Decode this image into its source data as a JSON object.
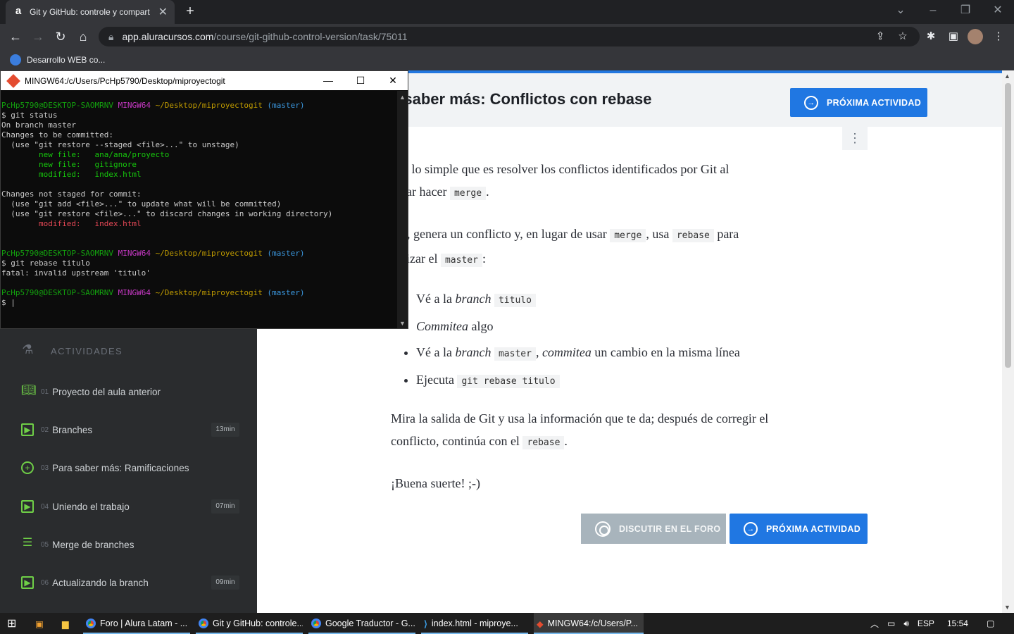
{
  "browser": {
    "tab_title": "Git y GitHub: controle y compart",
    "tab_favicon": "a",
    "url_host": "app.aluracursos.com",
    "url_path": "/course/git-github-control-version/task/75011",
    "bookmark_label": "Desarrollo WEB co..."
  },
  "terminal": {
    "title": "MINGW64:/c/Users/PcHp5790/Desktop/miproyectogit",
    "user": "PcHp5790@DESKTOP-SAOMRNV",
    "shell": "MINGW64",
    "path": "~/Desktop/miproyectogit",
    "branch": "(master)",
    "cmd1": "$ git status",
    "l_on_branch": "On branch master",
    "l_changes_committed": "Changes to be committed:",
    "l_restore_staged": "  (use \"git restore --staged <file>...\" to unstage)",
    "l_new1": "        new file:   ana/ana/proyecto",
    "l_new2": "        new file:   gitignore",
    "l_mod1": "        modified:   index.html",
    "l_not_staged": "Changes not staged for commit:",
    "l_add": "  (use \"git add <file>...\" to update what will be committed)",
    "l_restore": "  (use \"git restore <file>...\" to discard changes in working directory)",
    "l_mod2": "        modified:   index.html",
    "cmd2": "$ git rebase titulo",
    "l_fatal": "fatal: invalid upstream 'titulo'",
    "prompt": "$ |"
  },
  "page": {
    "title": "a saber más: Conflictos con rebase",
    "next_label": "PRÓXIMA ACTIVIDAD",
    "forum_label": "DISCUTIR EN EL FORO",
    "p1a": "nos lo simple que es resolver los conflictos identificados por Git al",
    "p1b": "entar hacer",
    "p1c": "merge",
    "p2a": "ora, genera un conflicto y, en lugar de usar",
    "p2b": "merge",
    "p2c": ", usa",
    "p2d": "rebase",
    "p2e": "para",
    "p2f": "ualizar el",
    "p2g": "master",
    "p2h": ":",
    "li1a": "Vé a la",
    "li1b": "branch",
    "li1c": "titulo",
    "li2a": "Commitea",
    "li2b": "algo",
    "li3a": "Vé a la",
    "li3b": "branch",
    "li3c": "master",
    "li3d": ",",
    "li3e": "commitea",
    "li3f": "un cambio en la misma línea",
    "li4a": "Ejecuta",
    "li4b": "git rebase titulo",
    "p3a": "Mira la salida de Git y usa la información que te da; después de corregir el",
    "p3b": "conflicto, continúa con el",
    "p3c": "rebase",
    "p3d": ".",
    "p4": "¡Buena suerte! ;-)"
  },
  "sidebar": {
    "section": "ACTIVIDADES",
    "items": [
      {
        "num": "01",
        "label": "Proyecto del aula anterior",
        "icon": "book-icon",
        "dur": ""
      },
      {
        "num": "02",
        "label": "Branches",
        "icon": "video-icon",
        "dur": "13min"
      },
      {
        "num": "03",
        "label": "Para saber más: Ramificaciones",
        "icon": "plus-circle-icon",
        "dur": ""
      },
      {
        "num": "04",
        "label": "Uniendo el trabajo",
        "icon": "video-icon",
        "dur": "07min"
      },
      {
        "num": "05",
        "label": "Merge de branches",
        "icon": "list-icon",
        "dur": ""
      },
      {
        "num": "06",
        "label": "Actualizando la branch",
        "icon": "video-icon",
        "dur": "09min"
      }
    ]
  },
  "taskbar": {
    "apps": [
      "Foro | Alura Latam - ...",
      "Git y GitHub: controle...",
      "Google Traductor - G...",
      "index.html - miproye...",
      "MINGW64:/c/Users/P..."
    ],
    "lang": "ESP",
    "time": "15:54"
  },
  "colors": {
    "accent": "#2077e2",
    "sidebar": "#2a2c2e",
    "green": "#6fcf47"
  }
}
